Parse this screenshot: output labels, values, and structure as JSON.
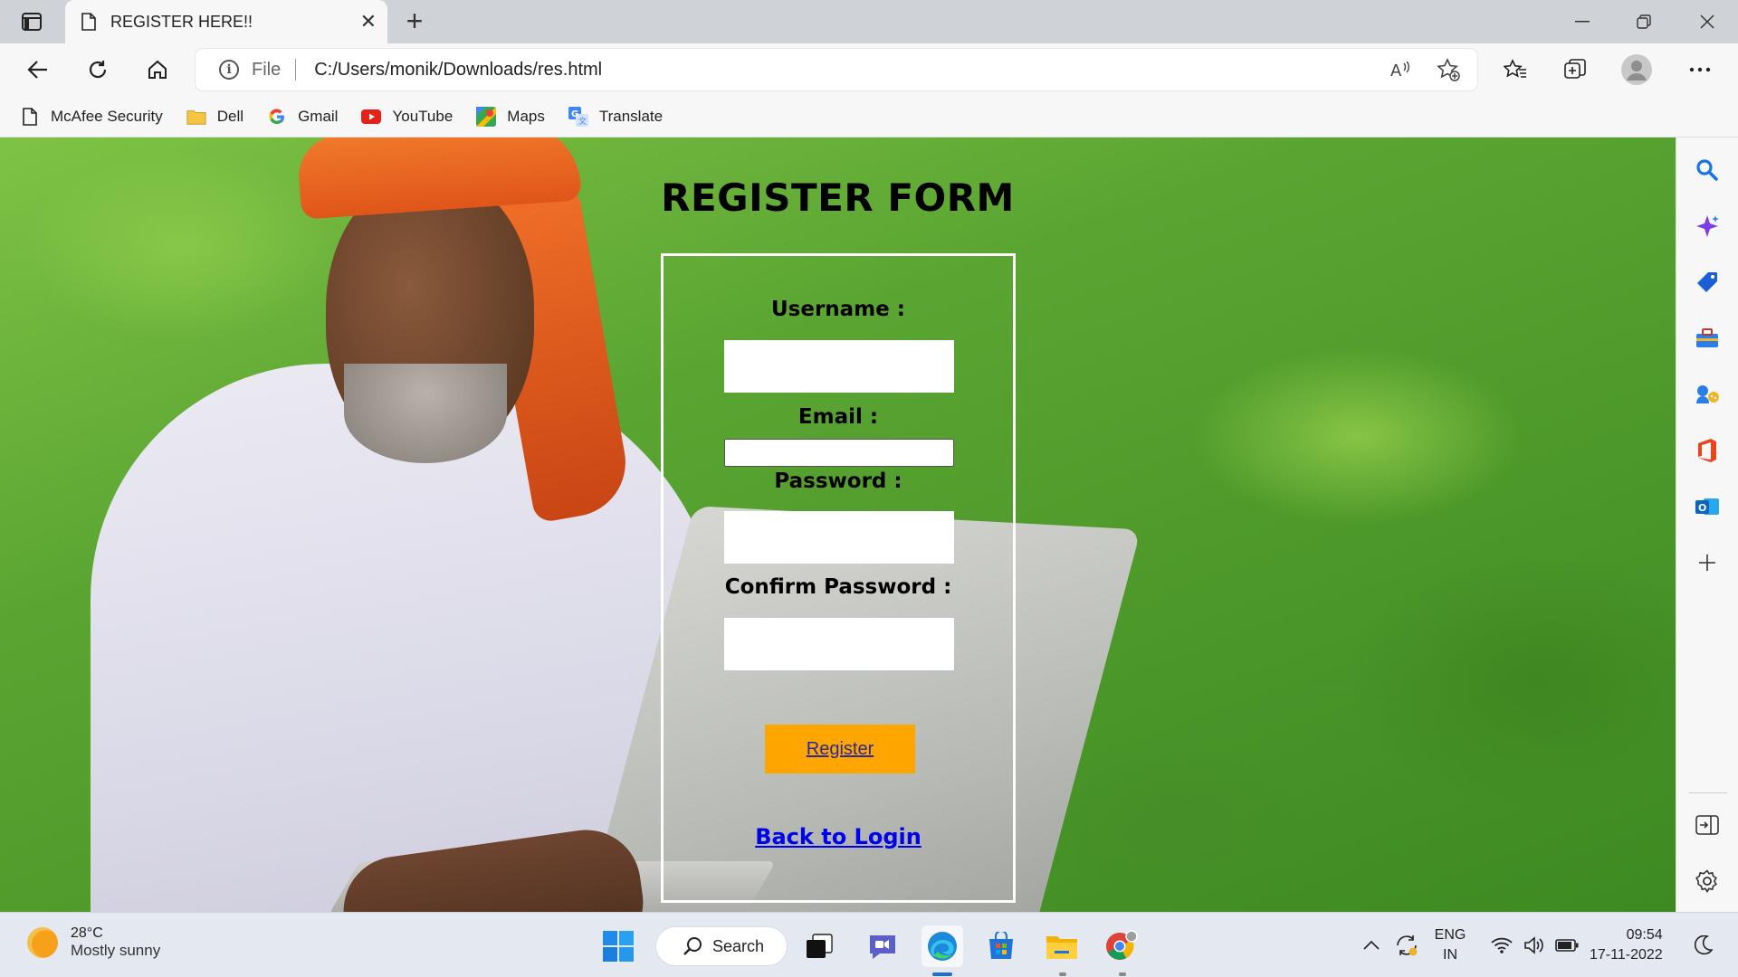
{
  "browser": {
    "tab_title": "REGISTER HERE!!",
    "url_scheme": "File",
    "url": "C:/Users/monik/Downloads/res.html",
    "favorites": [
      {
        "label": "McAfee Security",
        "icon": "document-icon"
      },
      {
        "label": "Dell",
        "icon": "folder-icon"
      },
      {
        "label": "Gmail",
        "icon": "google-icon"
      },
      {
        "label": "YouTube",
        "icon": "youtube-icon"
      },
      {
        "label": "Maps",
        "icon": "maps-icon"
      },
      {
        "label": "Translate",
        "icon": "translate-icon"
      }
    ]
  },
  "page": {
    "heading": "REGISTER FORM",
    "username_label": "Username :",
    "email_label": "Email :",
    "password_label": "Password :",
    "confirm_label": "Confirm Password :",
    "register_button": "Register",
    "back_link": "Back to Login",
    "username_value": "",
    "email_value": "",
    "password_value": "",
    "confirm_value": ""
  },
  "sidebar": {
    "icons": [
      "search-icon",
      "copilot-icon",
      "shopping-tag-icon",
      "tools-icon",
      "games-icon",
      "office-icon",
      "outlook-icon",
      "add-icon",
      "split-screen-icon",
      "settings-icon"
    ]
  },
  "taskbar": {
    "weather_temp": "28°C",
    "weather_desc": "Mostly sunny",
    "search_label": "Search",
    "language_top": "ENG",
    "language_bottom": "IN",
    "time": "09:54",
    "date": "17-11-2022"
  },
  "colors": {
    "register_button_bg": "#ffa500",
    "link": "#0000ee",
    "form_border": "#ffffff"
  }
}
